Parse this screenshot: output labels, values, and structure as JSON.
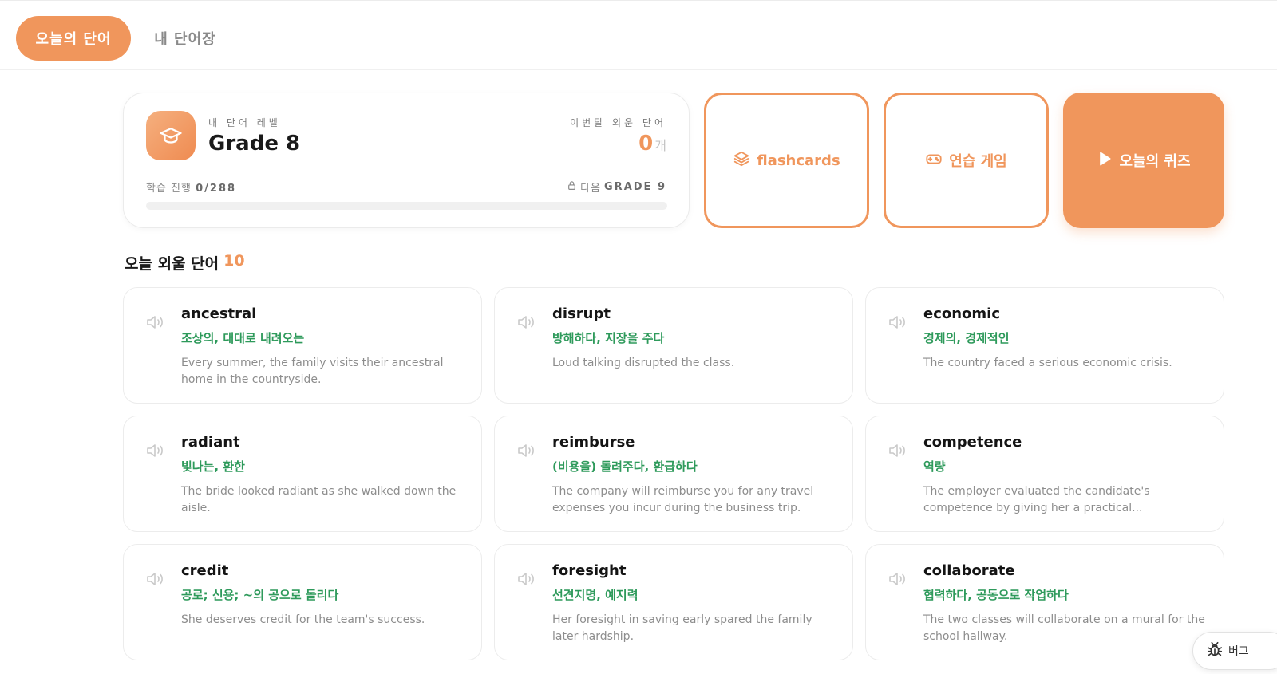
{
  "tabs": {
    "active": "오늘의 단어",
    "other": "내 단어장"
  },
  "level": {
    "label": "내 단어 레벨",
    "value": "Grade 8",
    "month_label": "이번달 외운 단어",
    "month_count": "0",
    "month_unit": "개",
    "progress_prefix": "학습 진행",
    "progress_text": "0/288",
    "progress_fraction": 0,
    "next_prefix": "다음",
    "next_grade": "GRADE 9"
  },
  "actions": {
    "flashcards": "flashcards",
    "game": "연습 게임",
    "quiz": "오늘의 퀴즈"
  },
  "section": {
    "title": "오늘 외울 단어",
    "count": "10"
  },
  "words": [
    {
      "word": "ancestral",
      "meaning": "조상의, 대대로 내려오는",
      "example": "Every summer, the family visits their ancestral home in the countryside."
    },
    {
      "word": "disrupt",
      "meaning": "방해하다, 지장을 주다",
      "example": "Loud talking disrupted the class."
    },
    {
      "word": "economic",
      "meaning": "경제의, 경제적인",
      "example": "The country faced a serious economic crisis."
    },
    {
      "word": "radiant",
      "meaning": "빛나는, 환한",
      "example": "The bride looked radiant as she walked down the aisle."
    },
    {
      "word": "reimburse",
      "meaning": "(비용을) 돌려주다, 환급하다",
      "example": "The company will reimburse you for any travel expenses you incur during the business trip."
    },
    {
      "word": "competence",
      "meaning": "역량",
      "example": "The employer evaluated the candidate's competence by giving her a practical..."
    },
    {
      "word": "credit",
      "meaning": "공로; 신용; ~의 공으로 돌리다",
      "example": "She deserves credit for the team's success."
    },
    {
      "word": "foresight",
      "meaning": "선견지명, 예지력",
      "example": "Her foresight in saving early spared the family later hardship."
    },
    {
      "word": "collaborate",
      "meaning": "협력하다, 공동으로 작업하다",
      "example": "The two classes will collaborate on a mural for the school hallway."
    }
  ],
  "bug_button": {
    "label": "버그"
  },
  "colors": {
    "accent": "#f0965c",
    "meaning": "#2e9a5b"
  },
  "icons": {
    "level": "graduation-cap-icon",
    "lock": "lock-icon",
    "flashcards": "layers-icon",
    "game": "gamepad-icon",
    "quiz": "play-icon",
    "speaker": "speaker-icon",
    "bug": "bug-icon"
  }
}
